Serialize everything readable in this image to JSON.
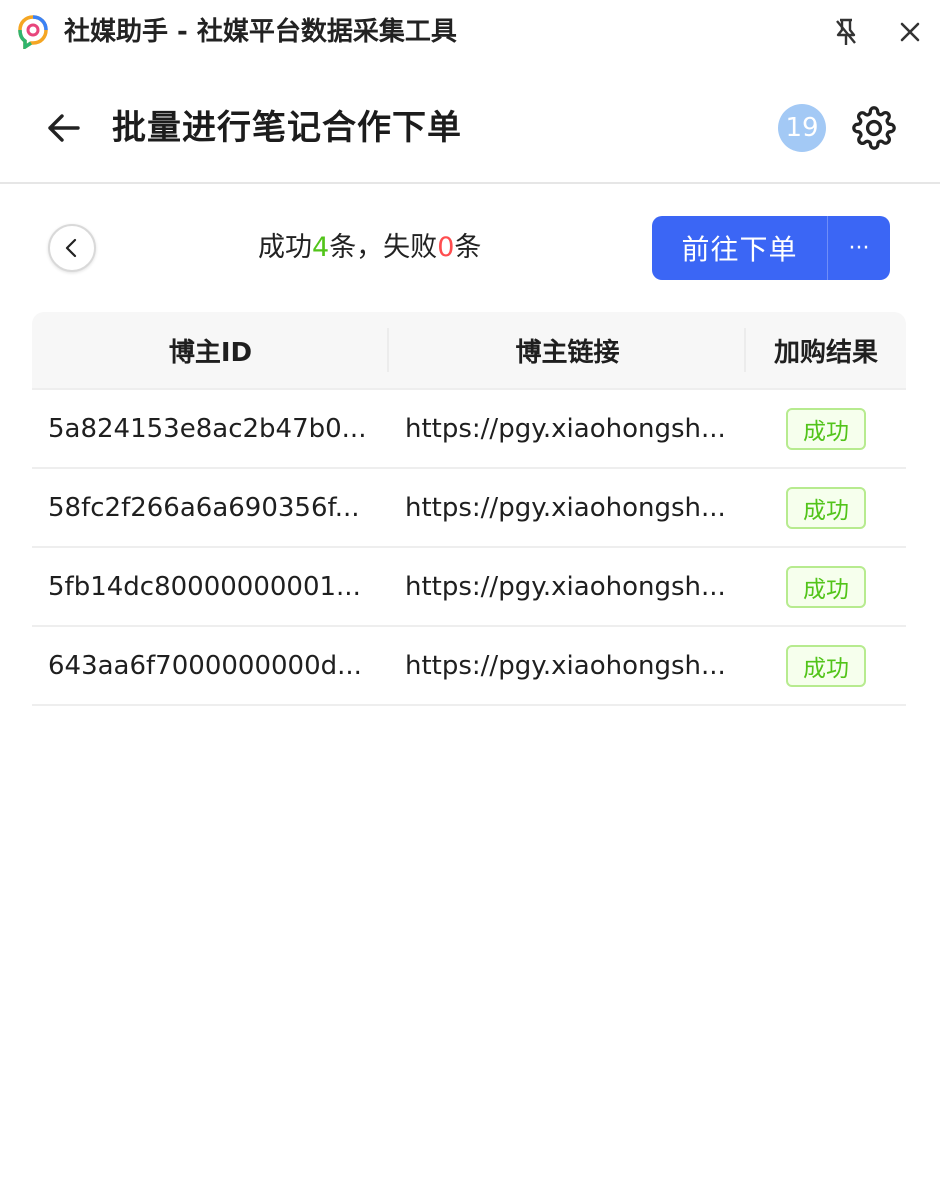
{
  "window": {
    "title": "社媒助手 - 社媒平台数据采集工具",
    "logo_icon": "app-logo-icon",
    "pin_icon": "unpin-icon",
    "close_icon": "close-icon"
  },
  "header": {
    "back_icon": "arrow-left-icon",
    "title": "批量进行笔记合作下单",
    "badge_count": "19",
    "settings_icon": "gear-icon"
  },
  "toolbar": {
    "back_icon": "chevron-left-icon",
    "summary": {
      "prefix": "成功",
      "success_count": "4",
      "middle": "条，失败",
      "fail_count": "0",
      "suffix": "条"
    },
    "primary_label": "前往下单",
    "more_label": "···"
  },
  "table": {
    "columns": [
      "博主ID",
      "博主链接",
      "加购结果"
    ],
    "rows": [
      {
        "id": "5a824153e8ac2b47b0...",
        "link": "https://pgy.xiaohongsh...",
        "result": "成功"
      },
      {
        "id": "58fc2f266a6a690356f...",
        "link": "https://pgy.xiaohongsh...",
        "result": "成功"
      },
      {
        "id": "5fb14dc80000000001...",
        "link": "https://pgy.xiaohongsh...",
        "result": "成功"
      },
      {
        "id": "643aa6f7000000000d...",
        "link": "https://pgy.xiaohongsh...",
        "result": "成功"
      }
    ]
  },
  "colors": {
    "primary": "#3b66f5",
    "success": "#52c41a",
    "fail": "#ff4d4f",
    "badge": "#a3c9f5"
  }
}
